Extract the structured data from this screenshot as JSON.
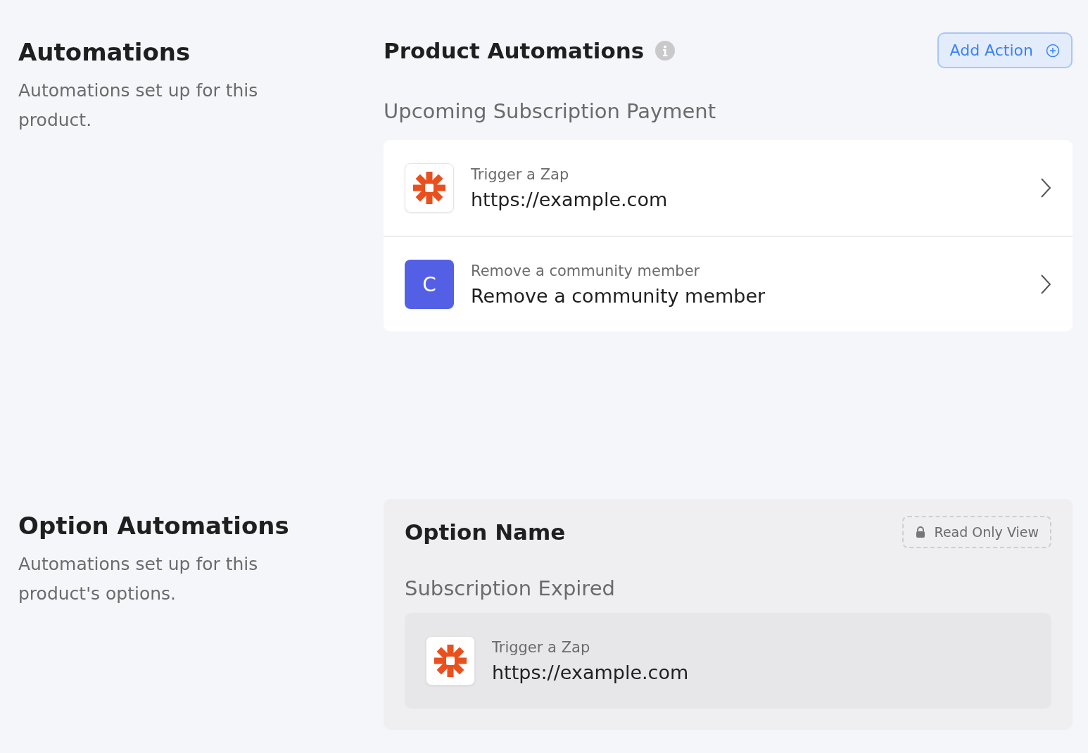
{
  "sections": [
    {
      "title": "Automations",
      "description": "Automations set up for this product.",
      "panel": {
        "kind": "product",
        "title": "Product Automations",
        "add_button": "Add Action",
        "group_title": "Upcoming Subscription Payment",
        "items": [
          {
            "kind": "zapier",
            "label": "Trigger a Zap",
            "value": "https://example.com"
          },
          {
            "kind": "letter",
            "letter": "C",
            "label": "Remove a community member",
            "value": "Remove a community member"
          }
        ]
      }
    },
    {
      "title": "Option Automations",
      "description": "Automations set up for this product's options.",
      "panel": {
        "kind": "option",
        "title": "Option Name",
        "badge": "Read Only View",
        "group_title": "Subscription Expired",
        "items": [
          {
            "kind": "zapier",
            "label": "Trigger a Zap",
            "value": "https://example.com"
          }
        ]
      }
    }
  ]
}
